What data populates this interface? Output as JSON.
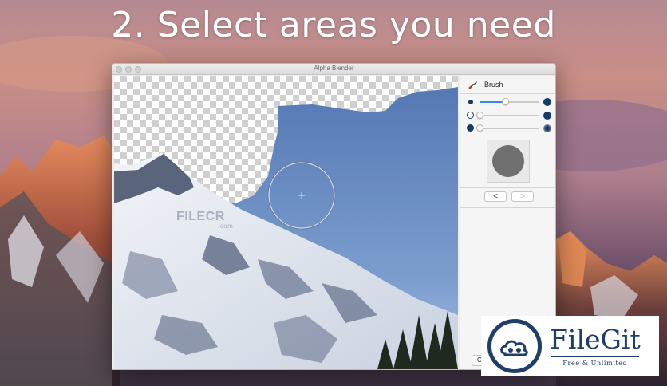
{
  "headline": "2. Select areas you need",
  "window": {
    "title": "Alpha Blender"
  },
  "watermark": {
    "text": "FILECR",
    "sub": ".com"
  },
  "panel": {
    "tool_title": "Brush",
    "tool_icon": "brush-icon",
    "sliders": [
      {
        "name": "brush-size",
        "value": 0.43
      },
      {
        "name": "brush-softness",
        "value": 0.0
      },
      {
        "name": "brush-opacity",
        "value": 0.0
      }
    ],
    "prev_label": "<",
    "next_label": ">",
    "ok_label": "Ok"
  },
  "badge": {
    "name": "FileGit",
    "tagline": "Free & Unlimited"
  },
  "colors": {
    "accent": "#3c85e0",
    "dark_blue": "#173a66",
    "badge_blue": "#1f3e6a"
  }
}
